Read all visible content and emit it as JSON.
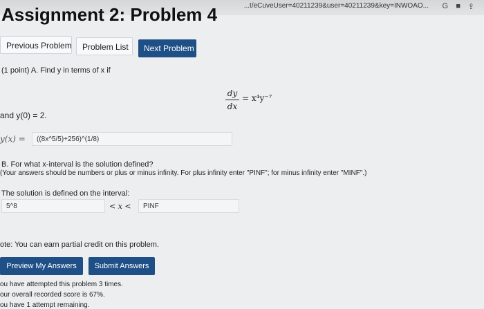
{
  "browser": {
    "url": "...t/eCuveUser=40211239&user=40211239&key=INWOAO...",
    "icons": [
      "google-icon",
      "extension-icon",
      "share-icon"
    ]
  },
  "page": {
    "title": "Assignment 2: Problem 4"
  },
  "nav": {
    "previous": "Previous Problem",
    "list": "Problem List",
    "next": "Next Problem"
  },
  "problem": {
    "points": "(1 point)",
    "part_a": "A. Find y in terms of x if",
    "equation_lhs_num": "dy",
    "equation_lhs_den": "dx",
    "equation_rhs": "= x⁴y⁻⁷",
    "initial_condition": "and y(0) = 2.",
    "answer_label": "y(x) =",
    "answer_value": "((8x^5/5)+256)^(1/8)",
    "part_b": "B. For what x-interval is the solution defined?",
    "instructions": "(Your answers should be numbers or plus or minus infinity. For plus infinity enter \"PINF\"; for minus infinity enter \"MINF\".)",
    "interval_label": "The solution is defined on the interval:",
    "interval_lower": "5^8",
    "interval_middle": "< x <",
    "interval_upper": "PINF"
  },
  "note": "ote: You can earn partial credit on this problem.",
  "actions": {
    "preview": "Preview My Answers",
    "submit": "Submit Answers"
  },
  "status": {
    "attempts": "ou have attempted this problem 3 times.",
    "score": "our overall recorded score is 67%.",
    "remaining": "ou have 1 attempt remaining."
  },
  "colors": {
    "primary_button": "#1e4f86",
    "background": "#eceef0"
  }
}
